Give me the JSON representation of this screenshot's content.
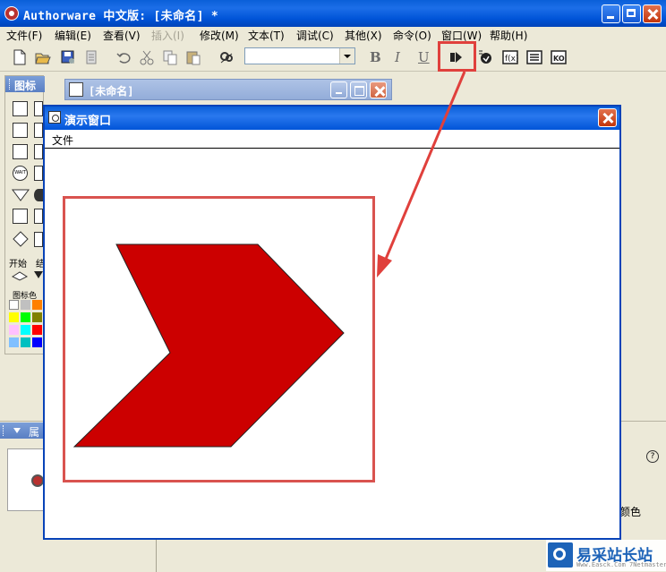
{
  "app": {
    "title": "Authorware 中文版: [未命名] *"
  },
  "menu": [
    {
      "label": "文件(F)"
    },
    {
      "label": "编辑(E)"
    },
    {
      "label": "查看(V)"
    },
    {
      "label": "插入(I)",
      "disabled": true
    },
    {
      "label": "修改(M)"
    },
    {
      "label": "文本(T)"
    },
    {
      "label": "调试(C)"
    },
    {
      "label": "其他(X)"
    },
    {
      "label": "命令(O)"
    },
    {
      "label": "窗口(W)"
    },
    {
      "label": "帮助(H)"
    }
  ],
  "toolbar": {
    "icons": [
      "new-file-icon",
      "open-file-icon",
      "save-all-icon",
      "import-icon",
      "undo-icon",
      "cut-icon",
      "copy-icon",
      "paste-icon",
      "find-icon"
    ],
    "style_combo_value": "",
    "bold": "B",
    "italic": "I",
    "underline": "U",
    "run_icon": "run-icon",
    "extra_icons": [
      "control-panel-icon",
      "functions-icon",
      "variables-icon",
      "knowledge-objects-icon"
    ]
  },
  "palette": {
    "title": "图标",
    "start_label": "开始",
    "stop_label": "结",
    "color_label": "图标色",
    "colors": [
      "#ffffff",
      "#c0c0c0",
      "#ffff00",
      "#ff8000",
      "#ff0000",
      "#ff00ff",
      "#00ff00",
      "#00ffff",
      "#0000ff",
      "#80ff80",
      "#ffc0ff",
      "#808080"
    ]
  },
  "bottom": {
    "panel_label": "属",
    "help_char": "?",
    "color_label": "颜色"
  },
  "doc_window": {
    "title": "[未命名]"
  },
  "presentation": {
    "title": "演示窗口",
    "menu_file": "文件",
    "shape_color": "#cc0000"
  },
  "watermark": {
    "text": "易采站长站",
    "sub": "Www.Easck.Com 7Netmaster"
  },
  "annotation": {
    "color": "#e0403c"
  }
}
